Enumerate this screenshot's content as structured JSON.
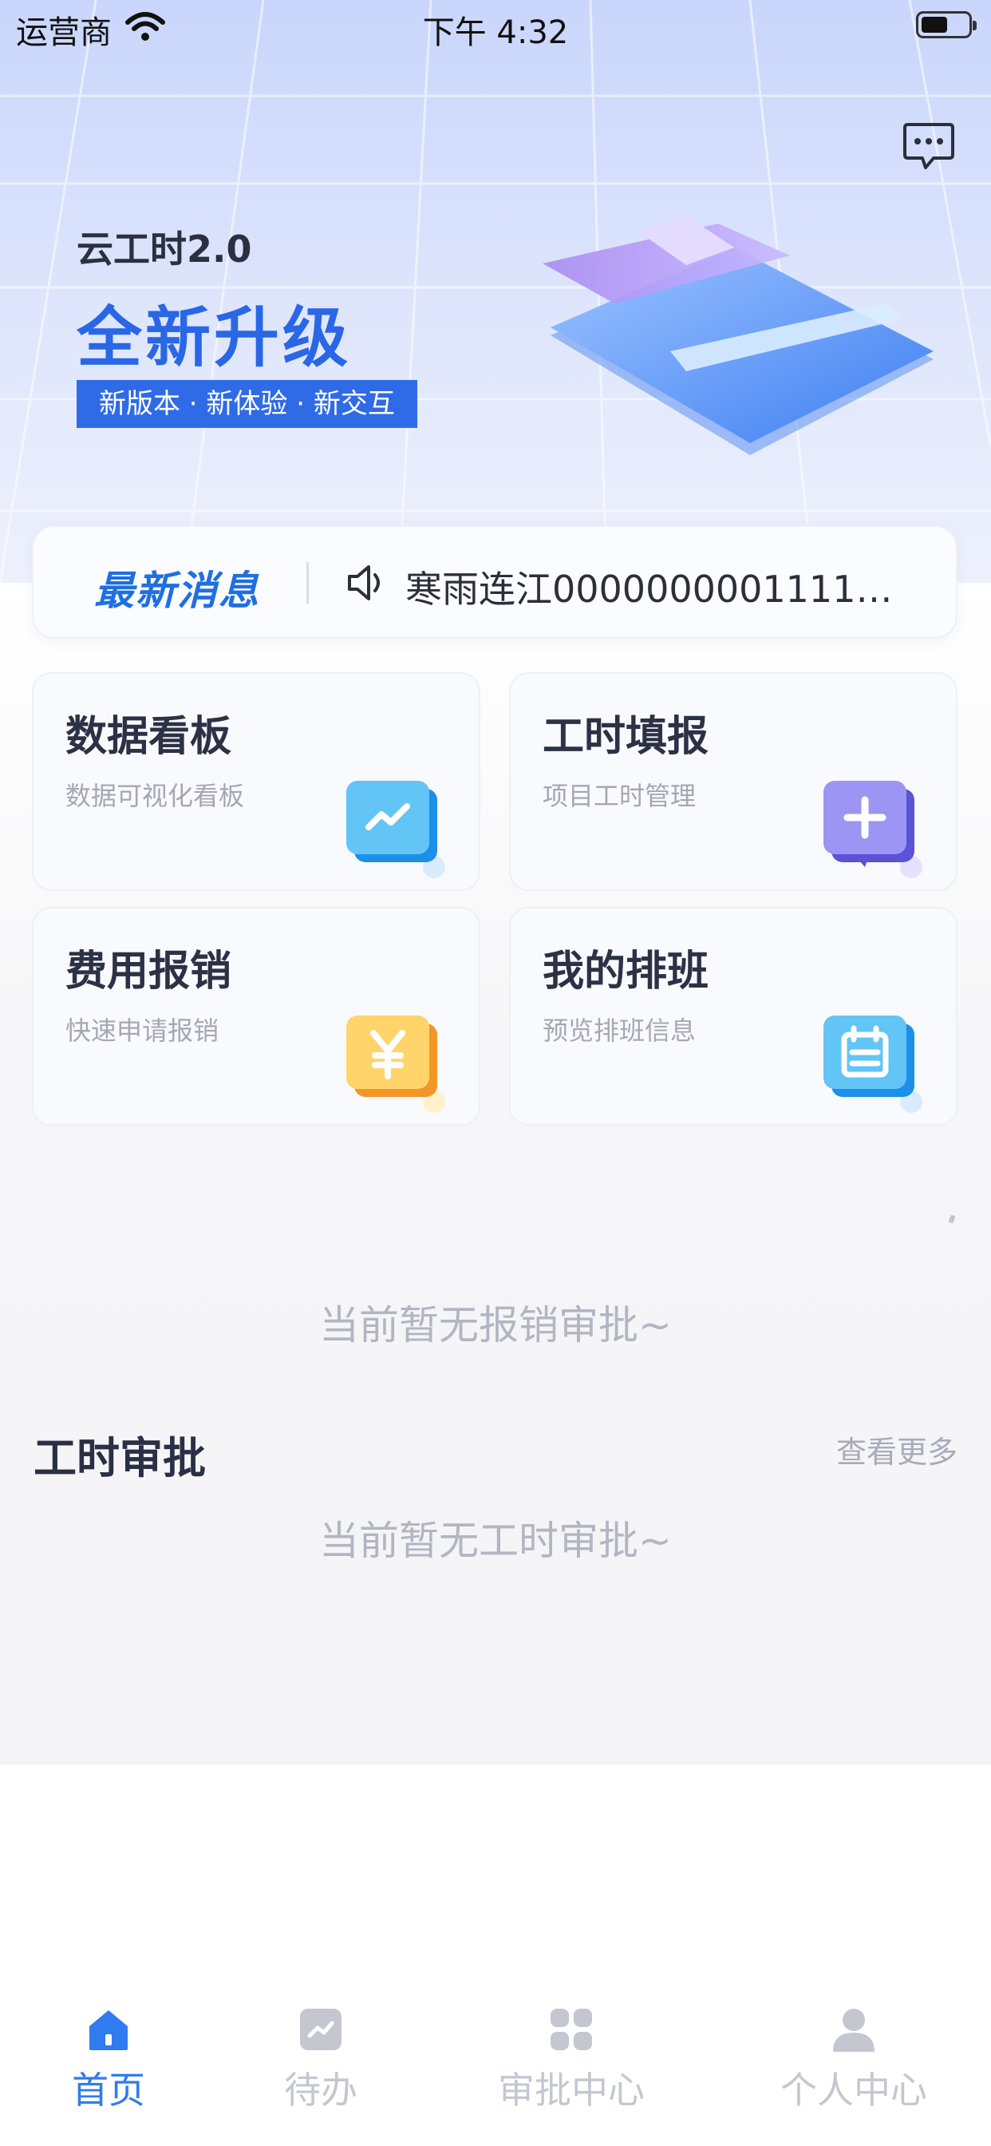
{
  "status_bar": {
    "carrier": "运营商",
    "time": "下午 4:32"
  },
  "banner": {
    "subtitle": "云工时2.0",
    "title": "全新升级",
    "tag": "新版本 · 新体验 · 新交互"
  },
  "notice": {
    "label": "最新消息",
    "text": "寒雨连江00000000011111..."
  },
  "cards": [
    {
      "title": "数据看板",
      "desc": "数据可视化看板",
      "icon": "chart-icon"
    },
    {
      "title": "工时填报",
      "desc": "项目工时管理",
      "icon": "add-icon"
    },
    {
      "title": "费用报销",
      "desc": "快速申请报销",
      "icon": "yen-icon"
    },
    {
      "title": "我的排班",
      "desc": "预览排班信息",
      "icon": "calendar-icon"
    }
  ],
  "expense_empty": "当前暂无报销审批~",
  "hours_section": {
    "title": "工时审批",
    "more": "查看更多",
    "empty": "当前暂无工时审批~"
  },
  "tabs": [
    {
      "label": "首页",
      "icon": "home-icon",
      "active": true
    },
    {
      "label": "待办",
      "icon": "todo-chart-icon",
      "active": false
    },
    {
      "label": "审批中心",
      "icon": "grid-icon",
      "active": false
    },
    {
      "label": "个人中心",
      "icon": "user-icon",
      "active": false
    }
  ],
  "colors": {
    "primary": "#2f6be6",
    "tab_active": "#2f7bf0",
    "tab_inactive": "#c4c7cf"
  }
}
